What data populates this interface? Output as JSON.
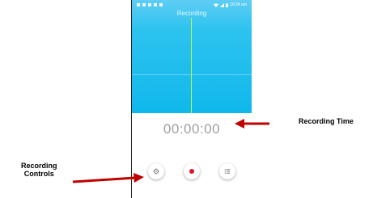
{
  "status_bar": {
    "time": "10:24 am",
    "left_icons": [
      "notification-icon",
      "notification-icon",
      "notification-icon",
      "notification-icon",
      "notification-icon"
    ],
    "right_icons": [
      "wifi-icon",
      "signal-icon",
      "battery-icon"
    ]
  },
  "app": {
    "title": "Recording",
    "timer": "00:00:00",
    "controls": [
      {
        "name": "settings",
        "icon": "gear-icon"
      },
      {
        "name": "record",
        "icon": "record-icon"
      },
      {
        "name": "recordings-list",
        "icon": "list-icon"
      }
    ]
  },
  "annotations": {
    "recording_time": "Recording Time",
    "recording_controls_line1": "Recording",
    "recording_controls_line2": "Controls"
  },
  "colors": {
    "screen_top": "#10b8eb",
    "playhead": "#b7ff3a",
    "record_dot": "#e0152b",
    "arrow": "#c00000",
    "timer_text": "#9e9e9e"
  }
}
